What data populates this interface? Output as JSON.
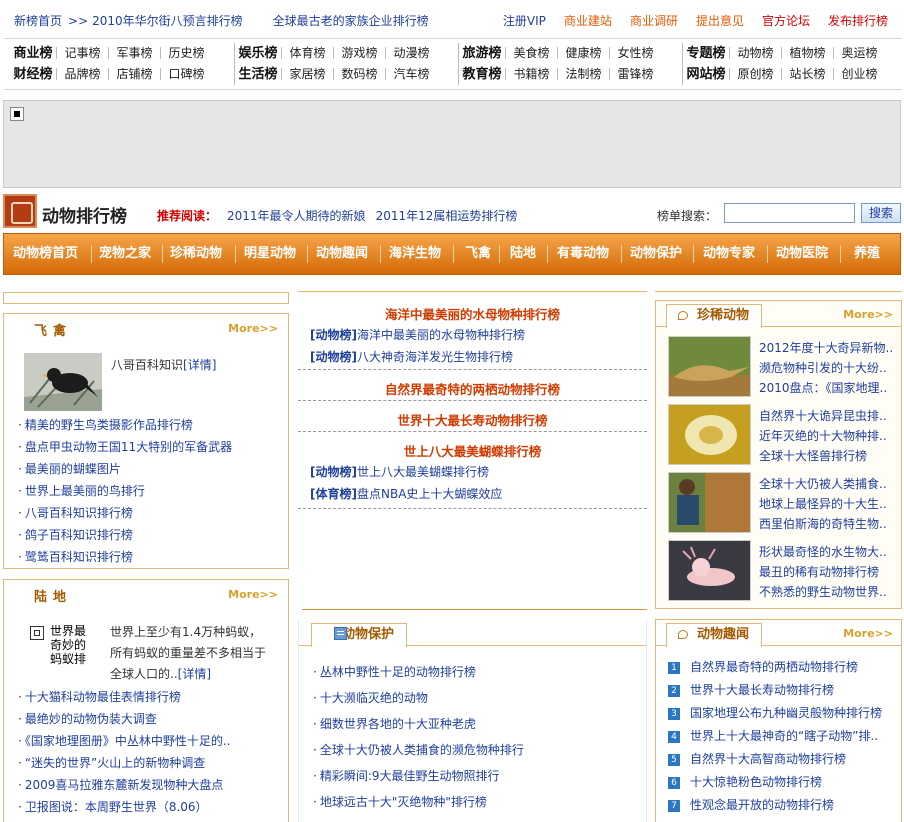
{
  "top": {
    "left": [
      "新榜首页",
      ">>",
      "2010年华尔街八预言排行榜",
      "全球最古老的家族企业排行榜"
    ],
    "right": [
      "注册VIP",
      "商业建站",
      "商业调研",
      "提出意见",
      "官方论坛",
      "发布排行榜"
    ]
  },
  "categories": [
    {
      "head": "商业榜",
      "items": [
        "记事榜",
        "军事榜",
        "历史榜"
      ]
    },
    {
      "head": "财经榜",
      "items": [
        "品牌榜",
        "店铺榜",
        "口碑榜"
      ]
    },
    {
      "head": "娱乐榜",
      "items": [
        "体育榜",
        "游戏榜",
        "动漫榜"
      ]
    },
    {
      "head": "生活榜",
      "items": [
        "家居榜",
        "数码榜",
        "汽车榜"
      ]
    },
    {
      "head": "旅游榜",
      "items": [
        "美食榜",
        "健康榜",
        "女性榜"
      ]
    },
    {
      "head": "教育榜",
      "items": [
        "书籍榜",
        "法制榜",
        "雷锋榜"
      ]
    },
    {
      "head": "专题榜",
      "items": [
        "动物榜",
        "植物榜",
        "奥运榜"
      ]
    },
    {
      "head": "网站榜",
      "items": [
        "原创榜",
        "站长榜",
        "创业榜"
      ]
    }
  ],
  "header": {
    "title": "动物排行榜",
    "rec_label": "推荐阅读：",
    "rec_links": [
      "2011年最令人期待的新娘",
      "2011年12属相运势排行榜"
    ],
    "search_label": "榜单搜索：",
    "search_value": "",
    "search_button": "搜索"
  },
  "nav": [
    "动物榜首页",
    "宠物之家",
    "珍稀动物",
    "明星动物",
    "动物趣闻",
    "海洋生物",
    "飞禽",
    "陆地",
    "有毒动物",
    "动物保护",
    "动物专家",
    "动物医院",
    "养殖"
  ],
  "left1": {
    "title": "飞禽",
    "more": "More>>",
    "featured": "八哥百科知识",
    "featured_link": "[详情]",
    "items": [
      "精美的野生鸟类摄影作品排行榜",
      "盘点甲虫动物王国11大特别的军备武器",
      "最美丽的蝴蝶图片",
      "世界上最美丽的鸟排行",
      "八哥百科知识排行榜",
      "鸽子百科知识排行榜",
      "鹭鸶百科知识排行榜"
    ]
  },
  "left2": {
    "title": "陆地",
    "more": "More>>",
    "img_alt": "世界最奇妙的蚂蚁排行",
    "desc1": "世界上至少有1.4万种蚂蚁，",
    "desc2": "所有蚂蚁的重量差不多相当于",
    "desc3": "全球人口的..",
    "desc_link": "[详情]",
    "items": [
      "十大猫科动物最佳表情排行榜",
      "最绝妙的动物伪装大调查",
      "《国家地理图册》中丛林中野性十足的..",
      "“迷失的世界”火山上的新物种调查",
      "2009喜马拉雅东麓新发现物种大盘点",
      "卫报图说：本周野生世界（8.06）"
    ]
  },
  "center": {
    "t1": "海洋中最美丽的水母物种排行榜",
    "e1": [
      {
        "tag": "[动物榜]",
        "text": "海洋中最美丽的水母物种排行榜"
      },
      {
        "tag": "[动物榜]",
        "text": "八大神奇海洋发光生物排行榜"
      }
    ],
    "t2": "自然界最奇特的两栖动物排行榜",
    "t3": "世界十大最长寿动物排行榜",
    "t4": "世上八大最美蝴蝶排行榜",
    "e4": [
      {
        "tag": "[动物榜]",
        "text": "世上八大最美蝴蝶排行榜"
      },
      {
        "tag": "[体育榜]",
        "text": "盘点NBA史上十大蝴蝶效应"
      }
    ]
  },
  "protect": {
    "title": "动物保护",
    "items": [
      "丛林中野性十足的动物排行榜",
      "十大濒临灭绝的动物",
      "细数世界各地的十大亚种老虎",
      "全球十大仍被人类捕食的濒危物种排行",
      "精彩瞬间:9大最佳野生动物照排行",
      "地球远古十大\"灭绝物种\"排行榜"
    ]
  },
  "rare": {
    "title": "珍稀动物",
    "more": "More>>",
    "groups": [
      [
        "2012年度十大奇异新物..",
        "濒危物种引发的十大纷..",
        "2010盘点：《国家地理.."
      ],
      [
        "自然界十大诡异昆虫排..",
        "近年灭绝的十大物种排..",
        "全球十大怪兽排行榜"
      ],
      [
        "全球十大仍被人类捕食..",
        "地球上最怪异的十大生..",
        "西里伯斯海的奇特生物.."
      ],
      [
        "形状最奇怪的水生物大..",
        "最丑的稀有动物排行榜",
        "不熟悉的野生动物世界.."
      ]
    ]
  },
  "fun": {
    "title": "动物趣闻",
    "more": "More>>",
    "items": [
      {
        "n": "1",
        "text": "自然界最奇特的两栖动物排行榜"
      },
      {
        "n": "2",
        "text": "世界十大最长寿动物排行榜"
      },
      {
        "n": "3",
        "text": "国家地理公布九种幽灵般物种排行榜"
      },
      {
        "n": "4",
        "text": "世界上十大最神奇的“瞎子动物”排.."
      },
      {
        "n": "5",
        "text": "自然界十大高智商动物排行榜"
      },
      {
        "n": "6",
        "text": "十大惊艳粉色动物排行榜"
      },
      {
        "n": "7",
        "text": "性观念最开放的动物排行榜"
      }
    ]
  },
  "colors": {
    "nav_top": "#f6a54a",
    "nav_bottom": "#d26a05",
    "link": "#1f3f9c",
    "accent_red": "#d13b00"
  }
}
